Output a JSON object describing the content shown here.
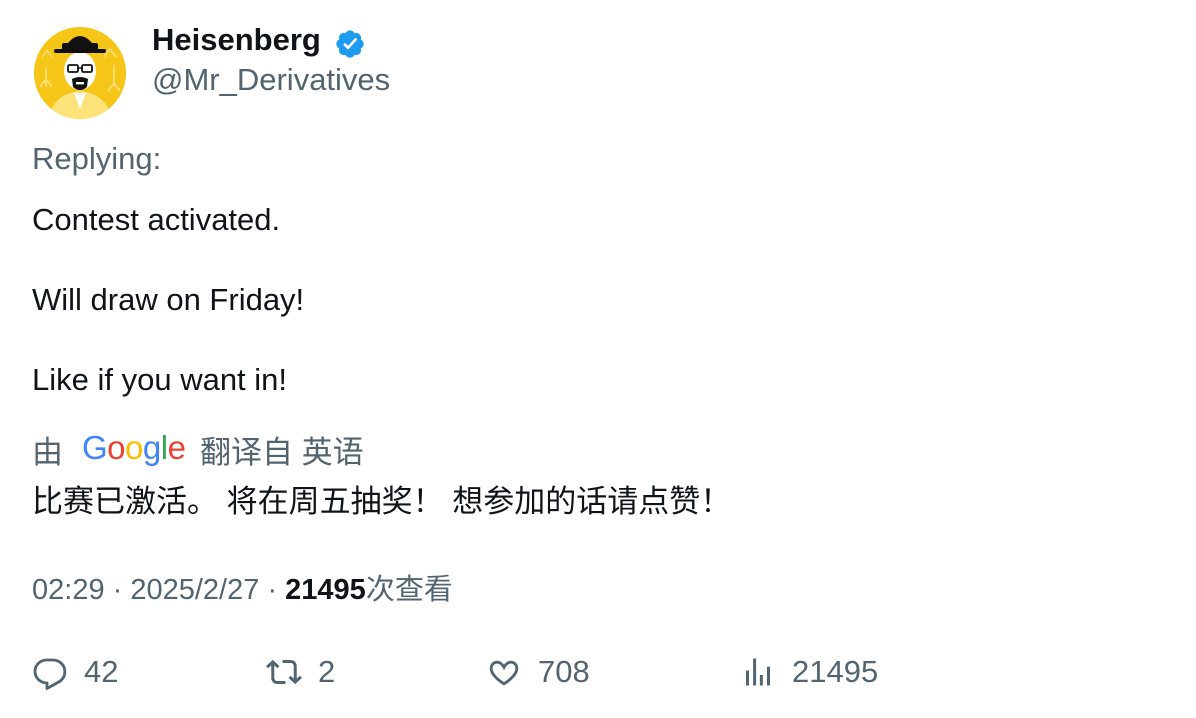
{
  "author": {
    "display_name": "Heisenberg",
    "handle": "@Mr_Derivatives",
    "verified_icon": "verified-badge-icon",
    "badge_color": "#1d9bf0"
  },
  "tweet": {
    "replying_label": "Replying:",
    "lines": [
      "Contest activated.",
      "Will draw on Friday!",
      "Like if you want in!"
    ]
  },
  "translation": {
    "by_label": "由",
    "provider": "Google",
    "from_label": "翻译自 英语",
    "text": "比赛已激活。 将在周五抽奖！ 想参加的话请点赞！"
  },
  "meta": {
    "time": "02:29",
    "separator": "·",
    "date": "2025/2/27",
    "views_count": "21495",
    "views_label": "次查看"
  },
  "actions": {
    "reply_count": "42",
    "retweet_count": "2",
    "like_count": "708",
    "views_count": "21495"
  },
  "colors": {
    "text_primary": "#0f1419",
    "text_secondary": "#536471",
    "avatar_background": "#f5c518"
  }
}
